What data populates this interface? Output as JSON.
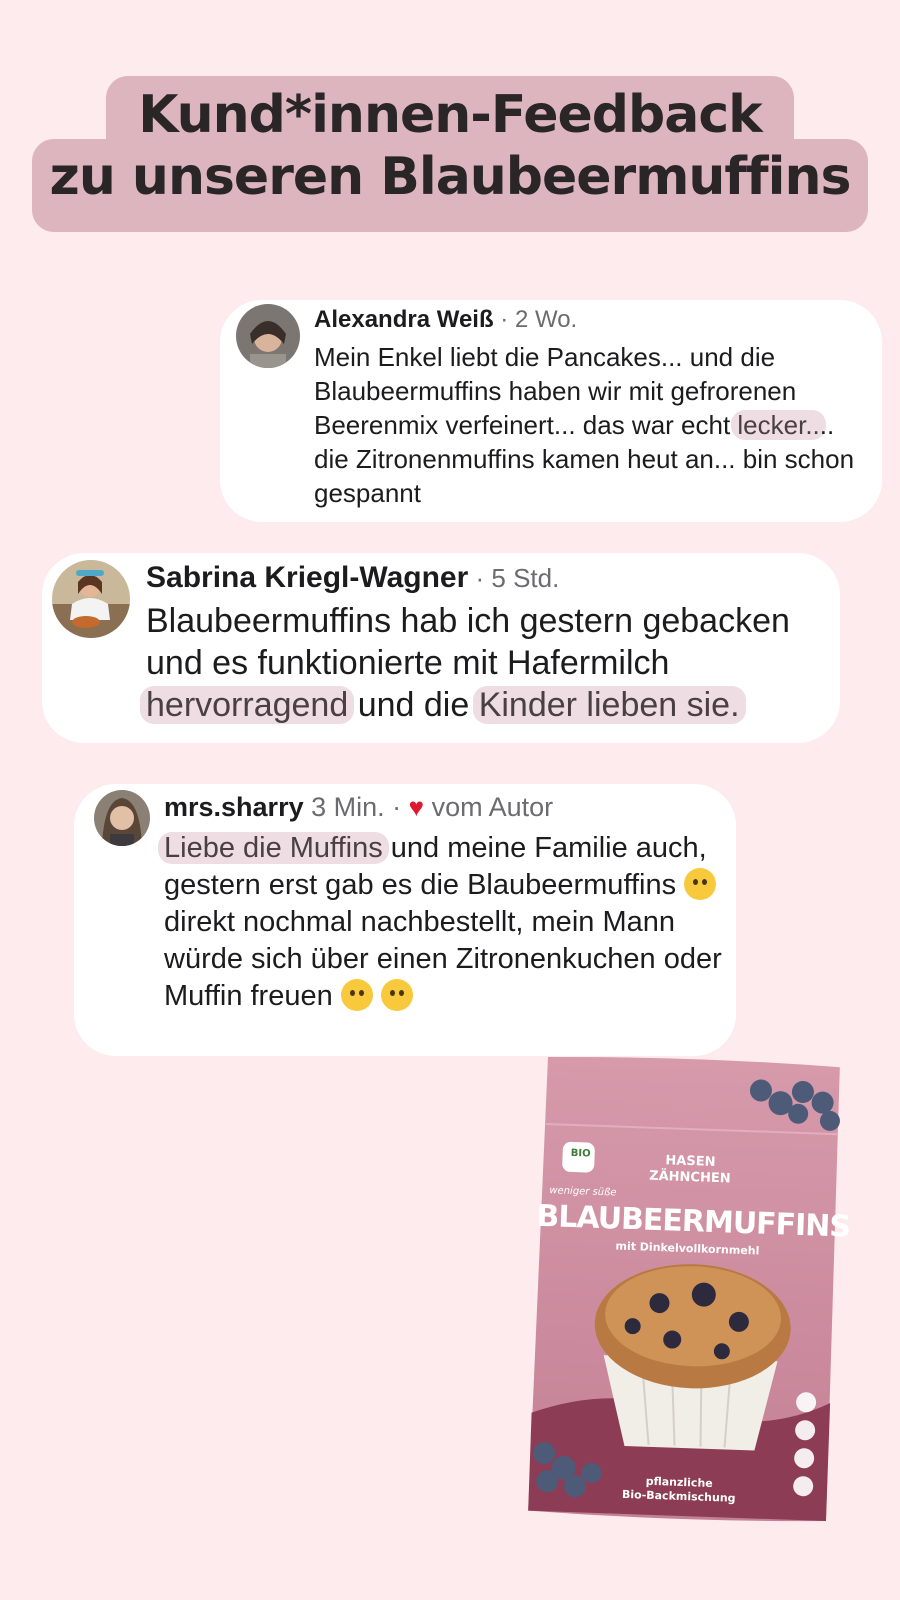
{
  "header": {
    "title_line1": "Kund*innen-Feedback",
    "title_line2": "zu unseren Blaubeermuffins"
  },
  "comments": [
    {
      "name": "Alexandra Weiß",
      "meta": " · 2 Wo.",
      "text_1": "Mein Enkel liebt die Pancakes... und die Blaubeermuffins haben wir mit gefrorenen Beerenmix verfeinert... das war echt ",
      "highlight_1": "lecker..",
      "text_2": ".. die Zitronenmuffins kamen heut an... bin schon gespannt"
    },
    {
      "name": "Sabrina Kriegl-Wagner",
      "meta": " · 5 Std.",
      "text_1": "Blaubeermuffins  hab ich gestern gebacken und es funktionierte mit Hafermilch ",
      "highlight_1": "hervorragend",
      "text_2": " und die ",
      "highlight_2": "Kinder lieben sie."
    },
    {
      "name": "mrs.sharry",
      "meta": " 3 Min. · ",
      "author_label": " vom Autor",
      "highlight_1": "Liebe die Muffins",
      "text_1": " und meine Familie auch, gestern erst gab es die Blaubeermuffins ",
      "text_2": " direkt nochmal nachbestellt, mein Mann würde sich über einen Zitronenkuchen oder Muffin freuen "
    }
  ],
  "product": {
    "brand_line1": "HASEN",
    "brand_line2": "ZÄHNCHEN",
    "bio_badge": "BIO",
    "tagline": "weniger süße",
    "name": "BLAUBEERMUFFINS",
    "subtitle": "mit Dinkelvollkornmehl",
    "footer_line1": "pflanzliche",
    "footer_line2": "Bio-Backmischung"
  },
  "colors": {
    "background": "#fdebee",
    "title_highlight": "#dcb5bf",
    "text_highlight": "#eedde2",
    "heart": "#e0182d",
    "package": "#c98a9b"
  }
}
